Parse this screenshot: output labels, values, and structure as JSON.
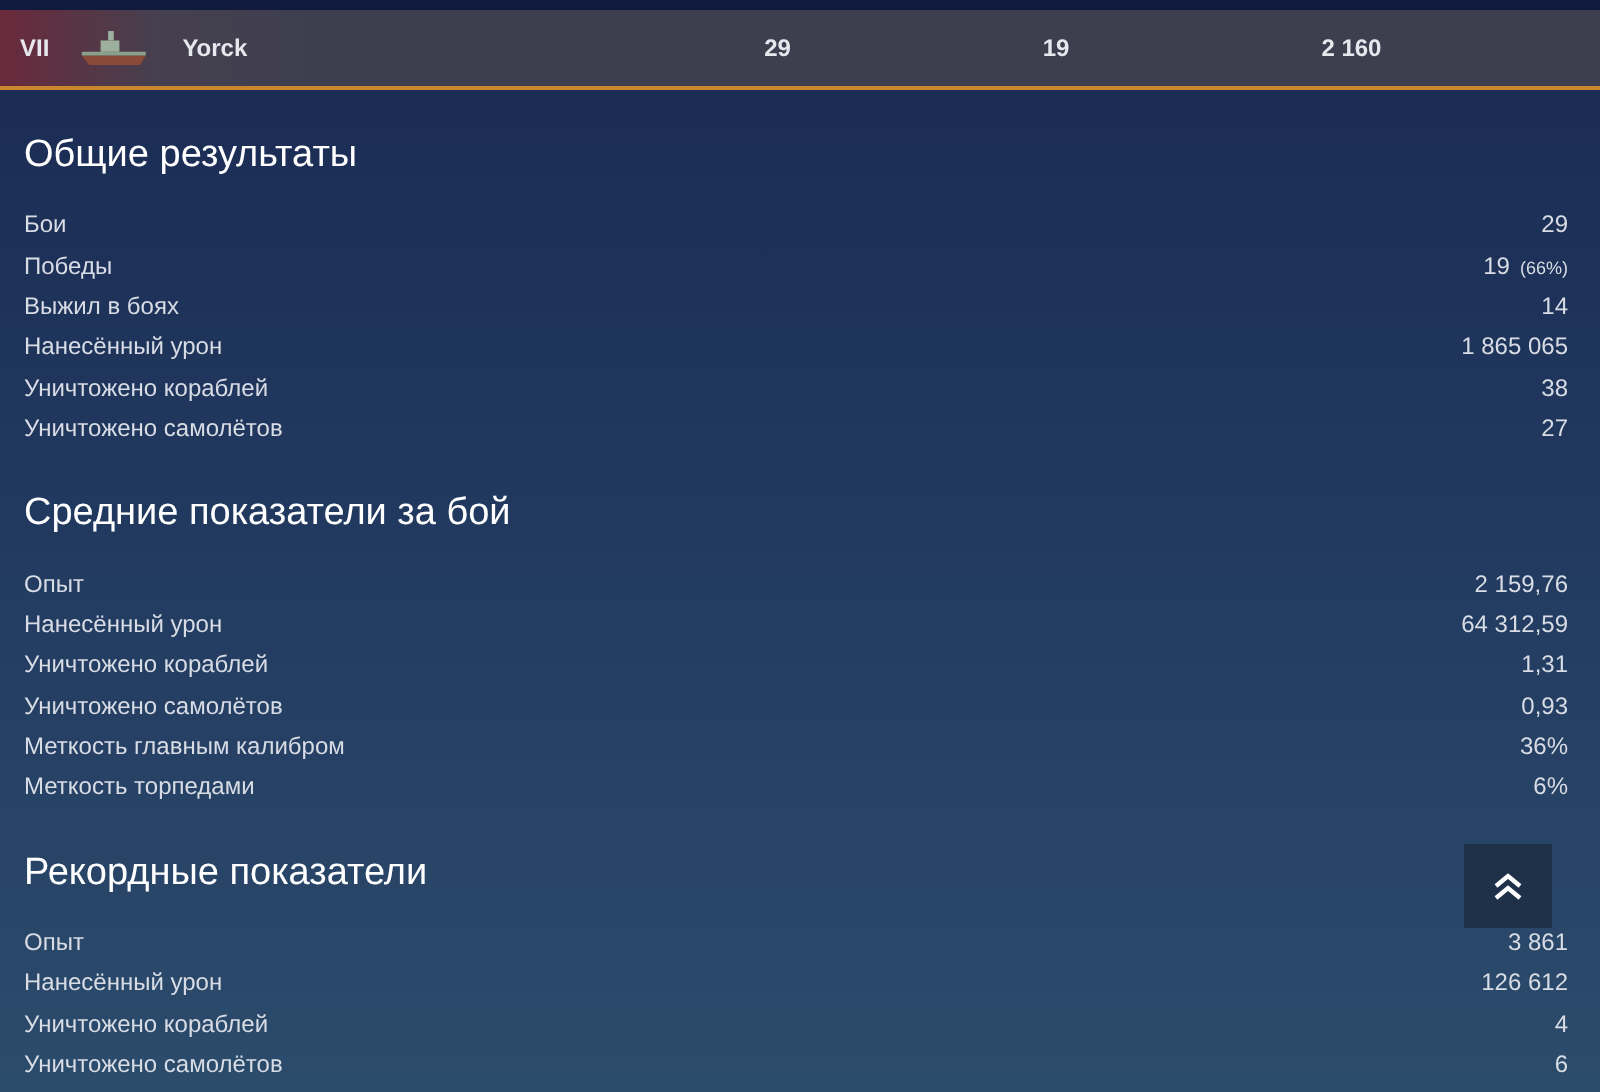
{
  "ship_row": {
    "tier": "VII",
    "name": "Yorck",
    "battles": "29",
    "wins": "19",
    "experience": "2 160"
  },
  "sections": [
    {
      "title": "Общие результаты",
      "rows": [
        {
          "label": "Бои",
          "value": "29"
        },
        {
          "label": "Победы",
          "value": "19",
          "note": "(66%)"
        },
        {
          "label": "Выжил в боях",
          "value": "14"
        },
        {
          "label": "Нанесённый урон",
          "value": "1 865 065"
        },
        {
          "label": "Уничтожено кораблей",
          "value": "38"
        },
        {
          "label": "Уничтожено самолётов",
          "value": "27"
        }
      ]
    },
    {
      "title": "Средние показатели за бой",
      "rows": [
        {
          "label": "Опыт",
          "value": "2 159,76"
        },
        {
          "label": "Нанесённый урон",
          "value": "64 312,59"
        },
        {
          "label": "Уничтожено кораблей",
          "value": "1,31"
        },
        {
          "label": "Уничтожено самолётов",
          "value": "0,93"
        },
        {
          "label": "Меткость главным калибром",
          "value": "36%"
        },
        {
          "label": "Меткость торпедами",
          "value": "6%"
        }
      ]
    },
    {
      "title": "Рекордные показатели",
      "rows": [
        {
          "label": "Опыт",
          "value": "3 861"
        },
        {
          "label": "Нанесённый урон",
          "value": "126 612"
        },
        {
          "label": "Уничтожено кораблей",
          "value": "4"
        },
        {
          "label": "Уничтожено самолётов",
          "value": "6"
        }
      ]
    }
  ]
}
